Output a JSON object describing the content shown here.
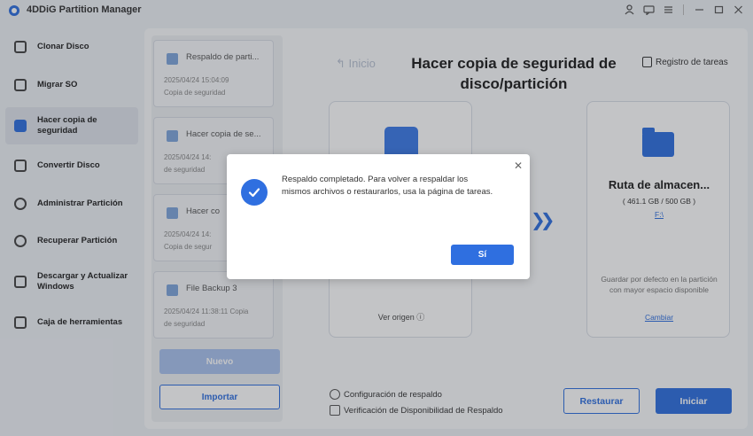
{
  "app": {
    "title": "4DDiG Partition Manager"
  },
  "sidebar": {
    "items": [
      {
        "label": "Clonar Disco",
        "icon": "clone-icon"
      },
      {
        "label": "Migrar SO",
        "icon": "migrate-icon"
      },
      {
        "label": "Hacer copia de seguridad",
        "icon": "backup-icon",
        "active": true
      },
      {
        "label": "Convertir Disco",
        "icon": "convert-icon"
      },
      {
        "label": "Administrar Partición",
        "icon": "partition-icon"
      },
      {
        "label": "Recuperar Partición",
        "icon": "recover-icon"
      },
      {
        "label": "Descargar y Actualizar Windows",
        "icon": "download-icon"
      },
      {
        "label": "Caja de herramientas",
        "icon": "toolbox-icon"
      }
    ]
  },
  "tasks": [
    {
      "name": "Respaldo de partición",
      "name_display": "Respaldo de parti...",
      "date": "2025/04/24 15:04:09",
      "type": "Copia de seguridad"
    },
    {
      "name_display": "Hacer copia de se...",
      "date": "2025/04/24 14:",
      "type": "de seguridad"
    },
    {
      "name_display": "Hacer co",
      "date": "2025/04/24 14:",
      "type": "Copia de segur"
    },
    {
      "name_display": "File Backup 3",
      "date": "2025/04/24 11:38:11 Copia",
      "type": "de seguridad"
    }
  ],
  "buttons": {
    "nuevo": "Nuevo",
    "importar": "Importar",
    "restaurar": "Restaurar",
    "iniciar": "Iniciar"
  },
  "main": {
    "back_label": "Inicio",
    "title": "Hacer copia de seguridad de disco/partición",
    "log_label": "Registro de tareas",
    "source_link": "Ver origen",
    "destination": {
      "title": "Ruta de almacen...",
      "size": "( 461.1 GB / 500 GB )",
      "drive": "F:\\",
      "description": "Guardar por defecto en la partición con mayor espacio disponible",
      "change": "Cambiar"
    },
    "options": {
      "config": "Configuración de respaldo",
      "verify": "Verificación de Disponibilidad de Respaldo"
    }
  },
  "dialog": {
    "message": "Respaldo completado. Para volver a respaldar los mismos archivos o restaurarlos, usa la página de tareas.",
    "confirm": "Sí"
  },
  "colors": {
    "accent": "#2f6fe0"
  }
}
